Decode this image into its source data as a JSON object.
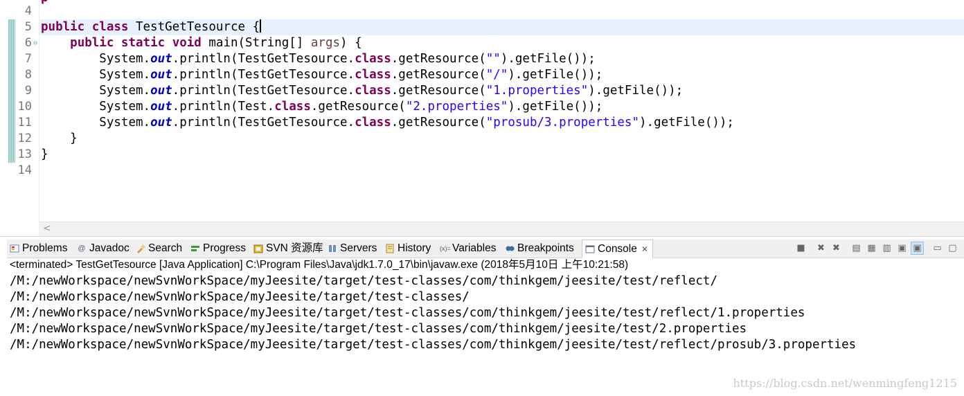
{
  "editor": {
    "line_numbers": [
      "4",
      "5",
      "6",
      "7",
      "8",
      "9",
      "10",
      "11",
      "12",
      "13",
      "14"
    ],
    "partial_top_text": "p",
    "lines": {
      "l5": {
        "kw1": "public",
        "kw2": "class",
        "name": " TestGetTesource {"
      },
      "l6": {
        "kw1": "public",
        "kw2": "static",
        "kw3": "void",
        "sig": " main(String[] ",
        "param": "args",
        "end": ") {"
      },
      "l7": {
        "a": "System.",
        "out": "out",
        "b": ".println(TestGetTesource.",
        "cls": "class",
        "c": ".getResource(",
        "s": "\"\"",
        "d": ").getFile());"
      },
      "l8": {
        "a": "System.",
        "out": "out",
        "b": ".println(TestGetTesource.",
        "cls": "class",
        "c": ".getResource(",
        "s": "\"/\"",
        "d": ").getFile());"
      },
      "l9": {
        "a": "System.",
        "out": "out",
        "b": ".println(TestGetTesource.",
        "cls": "class",
        "c": ".getResource(",
        "s": "\"1.properties\"",
        "d": ").getFile());"
      },
      "l10": {
        "a": "System.",
        "out": "out",
        "b": ".println(Test.",
        "cls": "class",
        "c": ".getResource(",
        "s": "\"2.properties\"",
        "d": ").getFile());"
      },
      "l11": {
        "a": "System.",
        "out": "out",
        "b": ".println(TestGetTesource.",
        "cls": "class",
        "c": ".getResource(",
        "s": "\"prosub/3.properties\"",
        "d": ").getFile());"
      },
      "l12": "    }",
      "l13": "}"
    },
    "scroll_left_glyph": "<"
  },
  "console": {
    "tabs": {
      "problems": "Problems",
      "javadoc": "Javadoc",
      "search": "Search",
      "progress": "Progress",
      "svn": "SVN 资源库",
      "servers": "Servers",
      "history": "History",
      "variables": "Variables",
      "breakpoints": "Breakpoints",
      "console": "Console"
    },
    "status": "<terminated> TestGetTesource [Java Application] C:\\Program Files\\Java\\jdk1.7.0_17\\bin\\javaw.exe (2018年5月10日 上午10:21:58)",
    "output": [
      "/M:/newWorkspace/newSvnWorkSpace/myJeesite/target/test-classes/com/thinkgem/jeesite/test/reflect/",
      "/M:/newWorkspace/newSvnWorkSpace/myJeesite/target/test-classes/",
      "/M:/newWorkspace/newSvnWorkSpace/myJeesite/target/test-classes/com/thinkgem/jeesite/test/reflect/1.properties",
      "/M:/newWorkspace/newSvnWorkSpace/myJeesite/target/test-classes/com/thinkgem/jeesite/test/2.properties",
      "/M:/newWorkspace/newSvnWorkSpace/myJeesite/target/test-classes/com/thinkgem/jeesite/test/reflect/prosub/3.properties"
    ]
  },
  "watermark": "https://blog.csdn.net/wenmingfeng1215",
  "colors": {
    "keyword": "#7f0055",
    "field": "#0000c0",
    "string": "#2a00ff",
    "current_line": "#e8f2fe",
    "quick_diff": "#8ec7c0"
  }
}
